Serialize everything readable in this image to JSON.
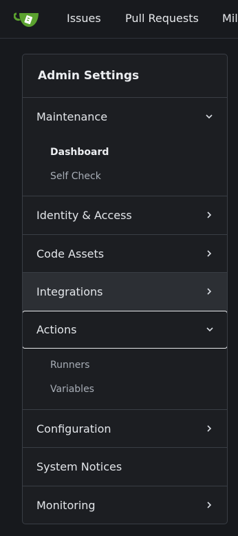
{
  "nav": {
    "logo_icon": "gitea-teacup-icon",
    "brand_color": "#5ba22f",
    "items": [
      "Issues",
      "Pull Requests",
      "Mil"
    ]
  },
  "panel": {
    "title": "Admin Settings",
    "sections": [
      {
        "label": "Maintenance",
        "expanded": true,
        "items": [
          "Dashboard",
          "Self Check"
        ],
        "active_item": "Dashboard"
      },
      {
        "label": "Identity & Access",
        "expanded": false
      },
      {
        "label": "Code Assets",
        "expanded": false
      },
      {
        "label": "Integrations",
        "expanded": false,
        "hovered": true
      },
      {
        "label": "Actions",
        "expanded": true,
        "focused": true,
        "items": [
          "Runners",
          "Variables"
        ]
      },
      {
        "label": "Configuration",
        "expanded": false
      },
      {
        "label": "System Notices",
        "expanded": false,
        "has_chevron": false
      },
      {
        "label": "Monitoring",
        "expanded": false
      }
    ]
  }
}
